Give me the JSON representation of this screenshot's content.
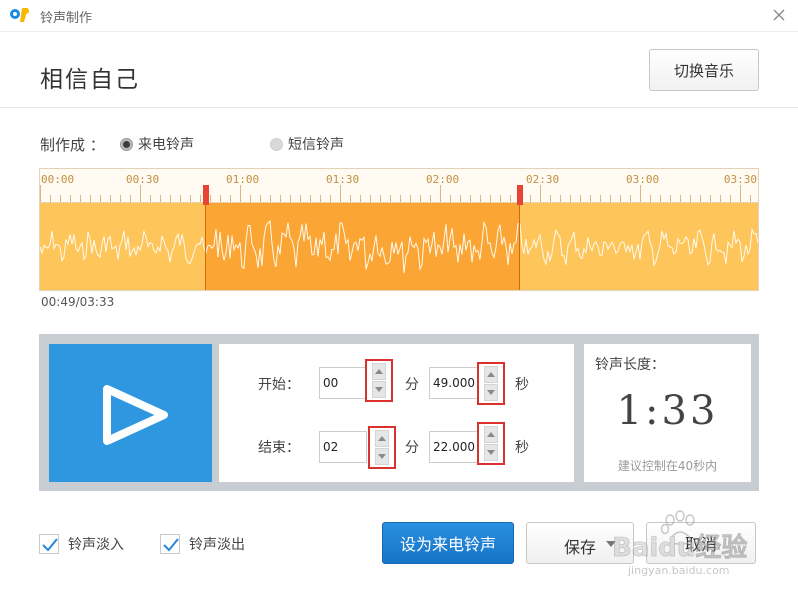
{
  "window": {
    "title": "铃声制作"
  },
  "header": {
    "song_title": "相信自己",
    "switch_label": "切换音乐"
  },
  "type_row": {
    "label": "制作成 ：",
    "options": [
      {
        "label": "来电铃声",
        "selected": true
      },
      {
        "label": "短信铃声",
        "selected": false
      }
    ]
  },
  "waveform": {
    "ticks": [
      "00:00",
      "00:30",
      "01:00",
      "01:30",
      "02:00",
      "02:30",
      "03:00",
      "03:30"
    ],
    "position_text": "00:49/03:33",
    "selection_start_seconds": 49,
    "selection_end_seconds": 142,
    "total_seconds": 213,
    "colors": {
      "wave": "#fdc55a",
      "selection": "#fba534",
      "handle": "#e84335"
    }
  },
  "time_panel": {
    "start_label": "开始：",
    "end_label": "结束：",
    "start_min": "00",
    "start_sec": "49.000",
    "end_min": "02",
    "end_sec": "22.000",
    "min_unit": "分",
    "sec_unit": "秒"
  },
  "length_panel": {
    "title": "铃声长度：",
    "value": "1:33",
    "hint": "建议控制在40秒内"
  },
  "options": {
    "fade_in_label": "铃声淡入",
    "fade_out_label": "铃声淡出",
    "fade_in_checked": true,
    "fade_out_checked": true
  },
  "buttons": {
    "set_label": "设为来电铃声",
    "save_label": "保存",
    "cancel_label": "取消"
  },
  "watermark": {
    "text": "Baidu经验",
    "sub": "jingyan.baidu.com"
  }
}
